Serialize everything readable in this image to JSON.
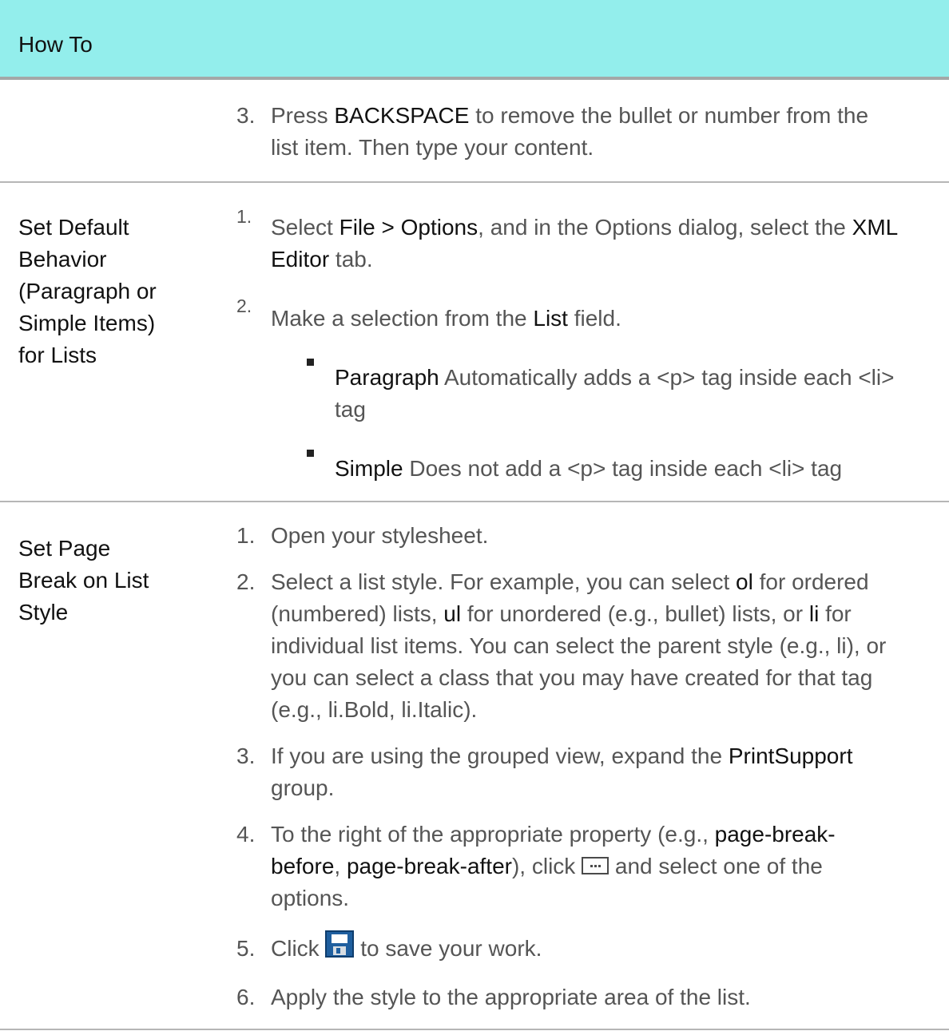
{
  "header": {
    "title": "How To"
  },
  "row1": {
    "step3_num": "3.",
    "step3_line1_pre": "Press ",
    "step3_line1_key": "BACKSPACE",
    "step3_line1_post": " to remove the bullet or number from the",
    "step3_line2": "list item. Then type your content."
  },
  "row2": {
    "label_lines": [
      "Set Default",
      "Behavior",
      "(Paragraph or",
      "Simple Items)",
      "for Lists"
    ],
    "step1_num": "1.",
    "step1_pre": "Select ",
    "step1_em1": "File > Options",
    "step1_mid": ", and in the Options dialog, select the ",
    "step1_em2a": "XML",
    "step1_em2b": "Editor",
    "step1_post": " tab.",
    "step2_num": "2.",
    "step2_pre": "Make a selection from the ",
    "step2_em": "List",
    "step2_post": " field.",
    "bullet1_em": "Paragraph",
    "bullet1_line1": " Automatically adds a <p> tag inside each <li>",
    "bullet1_line2": "tag",
    "bullet2_em": "Simple",
    "bullet2_text": " Does not add a <p> tag inside each <li> tag"
  },
  "row3": {
    "label_lines": [
      "Set Page",
      "Break on List",
      "Style"
    ],
    "nums": [
      "1.",
      "2.",
      "3.",
      "4.",
      "5.",
      "6."
    ],
    "s1": "Open your stylesheet.",
    "s2_l1_pre": "Select a list style. For example, you can select ",
    "s2_l1_em": "ol",
    "s2_l1_post": " for ordered",
    "s2_l2_pre": "(numbered) lists, ",
    "s2_l2_em1": "ul",
    "s2_l2_mid": " for unordered (e.g., bullet) lists, or ",
    "s2_l2_em2": "li",
    "s2_l2_post": " for",
    "s2_l3": "individual list items. You can select the parent style (e.g., li), or",
    "s2_l4": "you can select a class that you may have created for that tag",
    "s2_l5": "(e.g., li.Bold, li.Italic).",
    "s3_l1_pre": "If you are using the grouped view, expand the ",
    "s3_l1_em": "PrintSupport",
    "s3_l2": "group.",
    "s4_l1_pre": "To the right of the appropriate property (e.g., ",
    "s4_l1_em": "page-break-",
    "s4_l2_em1": "before",
    "s4_l2_sep": ", ",
    "s4_l2_em2": "page-break-after",
    "s4_l2_mid": "), click ",
    "s4_l2_post": " and select one of the",
    "s4_l3": "options.",
    "s5_pre": "Click ",
    "s5_post": " to save your work.",
    "s6": "Apply the style to the appropriate area of the list."
  },
  "icons": {
    "browse": "ellipsis-browse-icon",
    "save": "save-disk-icon"
  },
  "colors": {
    "header_bg": "#93eeec",
    "header_rule": "#a3a8a8",
    "row_rule": "#b6b6b6"
  }
}
